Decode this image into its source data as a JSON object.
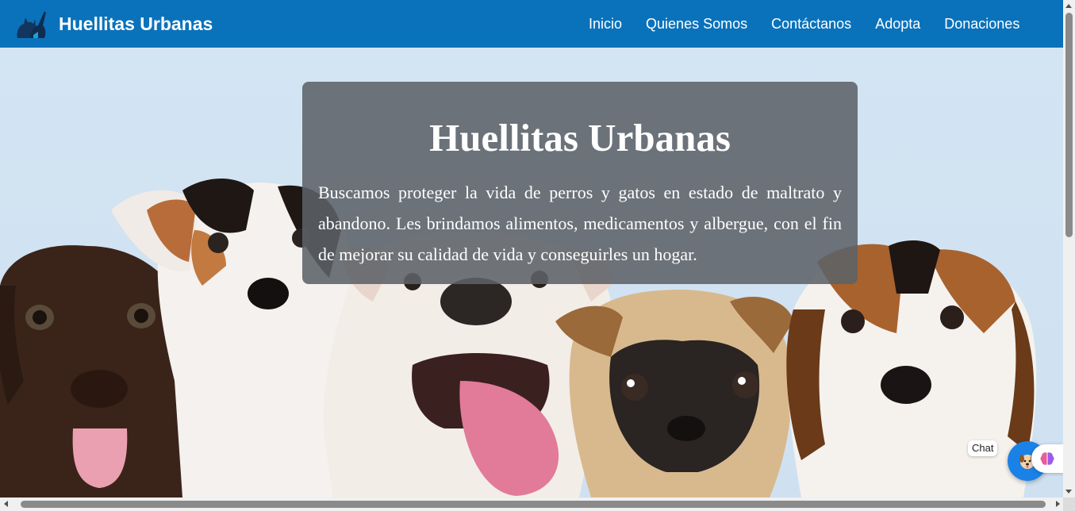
{
  "navbar": {
    "brand": "Huellitas Urbanas",
    "links": [
      "Inicio",
      "Quienes Somos",
      "Contáctanos",
      "Adopta",
      "Donaciones"
    ]
  },
  "hero": {
    "title": "Huellitas Urbanas",
    "text": "Buscamos proteger la vida de perros y gatos en estado de maltrato y abandono. Les brindamos alimentos, medicamentos y albergue, con el fin de mejorar su calidad de vida y conseguirles un hogar."
  },
  "chat": {
    "label": "Chat"
  },
  "colors": {
    "navbar": "#0a72bb",
    "hero_bg": "#d3e4f3",
    "card": "#5c6268",
    "chat_button": "#1a82e6"
  },
  "icons": {
    "brand": "cat-dog-logo-icon",
    "chat": "dog-face-icon",
    "assistant": "brain-icon"
  }
}
